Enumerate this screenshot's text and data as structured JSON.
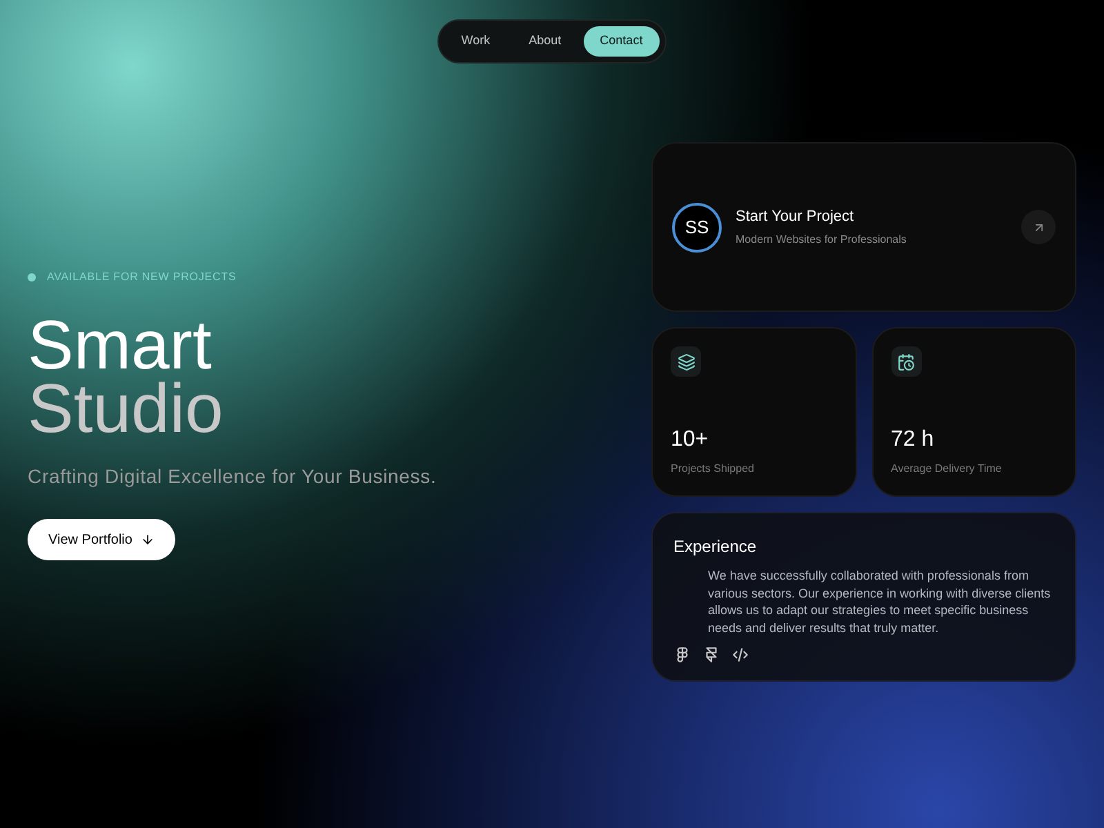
{
  "nav": {
    "tabs": [
      {
        "label": "Work",
        "selected": false
      },
      {
        "label": "About",
        "selected": false
      },
      {
        "label": "Contact",
        "selected": true
      }
    ]
  },
  "hero": {
    "status": {
      "label": "AVAILABLE FOR NEW PROJECTS",
      "color": "#7fd6cb"
    },
    "title_lines": [
      "Smart",
      "Studio"
    ],
    "subtitle": "Crafting Digital Excellence for Your Business.",
    "button": "View Portfolio"
  },
  "project_card": {
    "avatar": "SS",
    "title": "Start Your Project",
    "subtitle": "Modern Websites for Professionals"
  },
  "stats": [
    {
      "kind": "layers",
      "value": "10+",
      "label": "Projects Shipped"
    },
    {
      "kind": "calendar",
      "value": "72 h",
      "label": "Average Delivery Time"
    }
  ],
  "experience": {
    "title": "Experience",
    "text": "We have successfully collaborated with professionals from various sectors. Our experience in working with diverse clients allows us to adapt our strategies to meet specific business needs and deliver results that truly matter.",
    "tools": [
      {
        "kind": "figma"
      },
      {
        "kind": "framer"
      },
      {
        "kind": "code"
      }
    ]
  }
}
